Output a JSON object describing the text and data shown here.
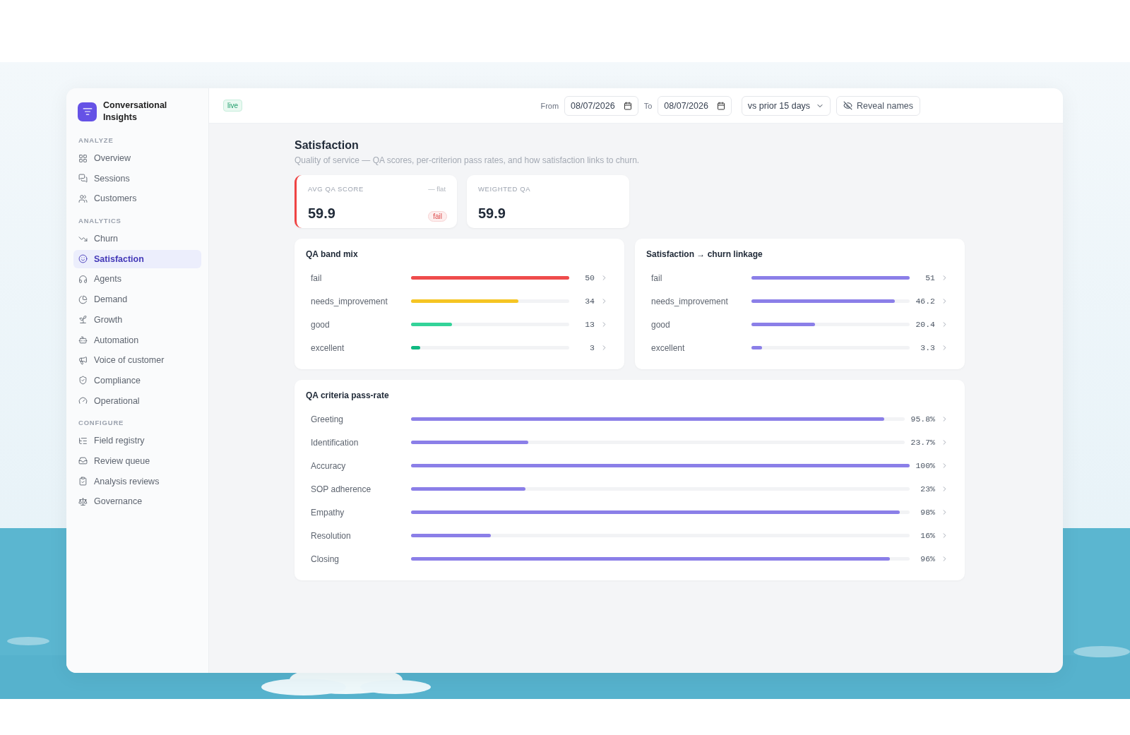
{
  "app": {
    "name": "Conversational Insights"
  },
  "sidebar": {
    "sections": [
      {
        "title": "ANALYZE",
        "items": [
          {
            "label": "Overview",
            "selected": false
          },
          {
            "label": "Sessions",
            "selected": false
          },
          {
            "label": "Customers",
            "selected": false
          }
        ]
      },
      {
        "title": "ANALYTICS",
        "items": [
          {
            "label": "Churn",
            "selected": false
          },
          {
            "label": "Satisfaction",
            "selected": true
          },
          {
            "label": "Agents",
            "selected": false
          },
          {
            "label": "Demand",
            "selected": false
          },
          {
            "label": "Growth",
            "selected": false
          },
          {
            "label": "Automation",
            "selected": false
          },
          {
            "label": "Voice of customer",
            "selected": false
          },
          {
            "label": "Compliance",
            "selected": false
          },
          {
            "label": "Operational",
            "selected": false
          }
        ]
      },
      {
        "title": "CONFIGURE",
        "items": [
          {
            "label": "Field registry",
            "selected": false
          },
          {
            "label": "Review queue",
            "selected": false
          },
          {
            "label": "Analysis reviews",
            "selected": false
          },
          {
            "label": "Governance",
            "selected": false
          }
        ]
      }
    ]
  },
  "header": {
    "badge": "live",
    "from_label": "From",
    "from_date": "08/07/2026",
    "to_label": "To",
    "to_date": "08/07/2026",
    "compare": "vs prior 15 days",
    "reveal_button": "Reveal names"
  },
  "page": {
    "title": "Satisfaction",
    "subtitle": "Quality of service — QA scores, per-criterion pass rates, and how satisfaction links to churn."
  },
  "kpis": [
    {
      "label": "AVG QA SCORE",
      "value": "59.9",
      "trend": "— flat",
      "status": "fail",
      "alert": true
    },
    {
      "label": "WEIGHTED QA",
      "value": "59.9",
      "alert": false
    }
  ],
  "band_mix": {
    "title": "QA band mix",
    "rows": [
      {
        "label": "fail",
        "value": "50",
        "level": 1,
        "color": "#ef4c4c"
      },
      {
        "label": "needs_improvement",
        "value": "34",
        "level": 0.68,
        "color": "#f5c524"
      },
      {
        "label": "good",
        "value": "13",
        "level": 0.26,
        "color": "#34d399"
      },
      {
        "label": "excellent",
        "value": "3",
        "level": 0.06,
        "color": "#10b981"
      }
    ]
  },
  "churn_linkage": {
    "title": "Satisfaction → churn linkage",
    "rows": [
      {
        "label": "fail",
        "value": "51",
        "level": 1
      },
      {
        "label": "needs_improvement",
        "value": "46.2",
        "level": 0.906
      },
      {
        "label": "good",
        "value": "20.4",
        "level": 0.4
      },
      {
        "label": "excellent",
        "value": "3.3",
        "level": 0.065
      }
    ]
  },
  "criteria": {
    "title": "QA criteria pass-rate",
    "rows": [
      {
        "label": "Greeting",
        "value": "95.8%",
        "level": 0.958
      },
      {
        "label": "Identification",
        "value": "23.7%",
        "level": 0.237
      },
      {
        "label": "Accuracy",
        "value": "100%",
        "level": 1
      },
      {
        "label": "SOP adherence",
        "value": "23%",
        "level": 0.23
      },
      {
        "label": "Empathy",
        "value": "98%",
        "level": 0.98
      },
      {
        "label": "Resolution",
        "value": "16%",
        "level": 0.16
      },
      {
        "label": "Closing",
        "value": "96%",
        "level": 0.96
      }
    ]
  }
}
